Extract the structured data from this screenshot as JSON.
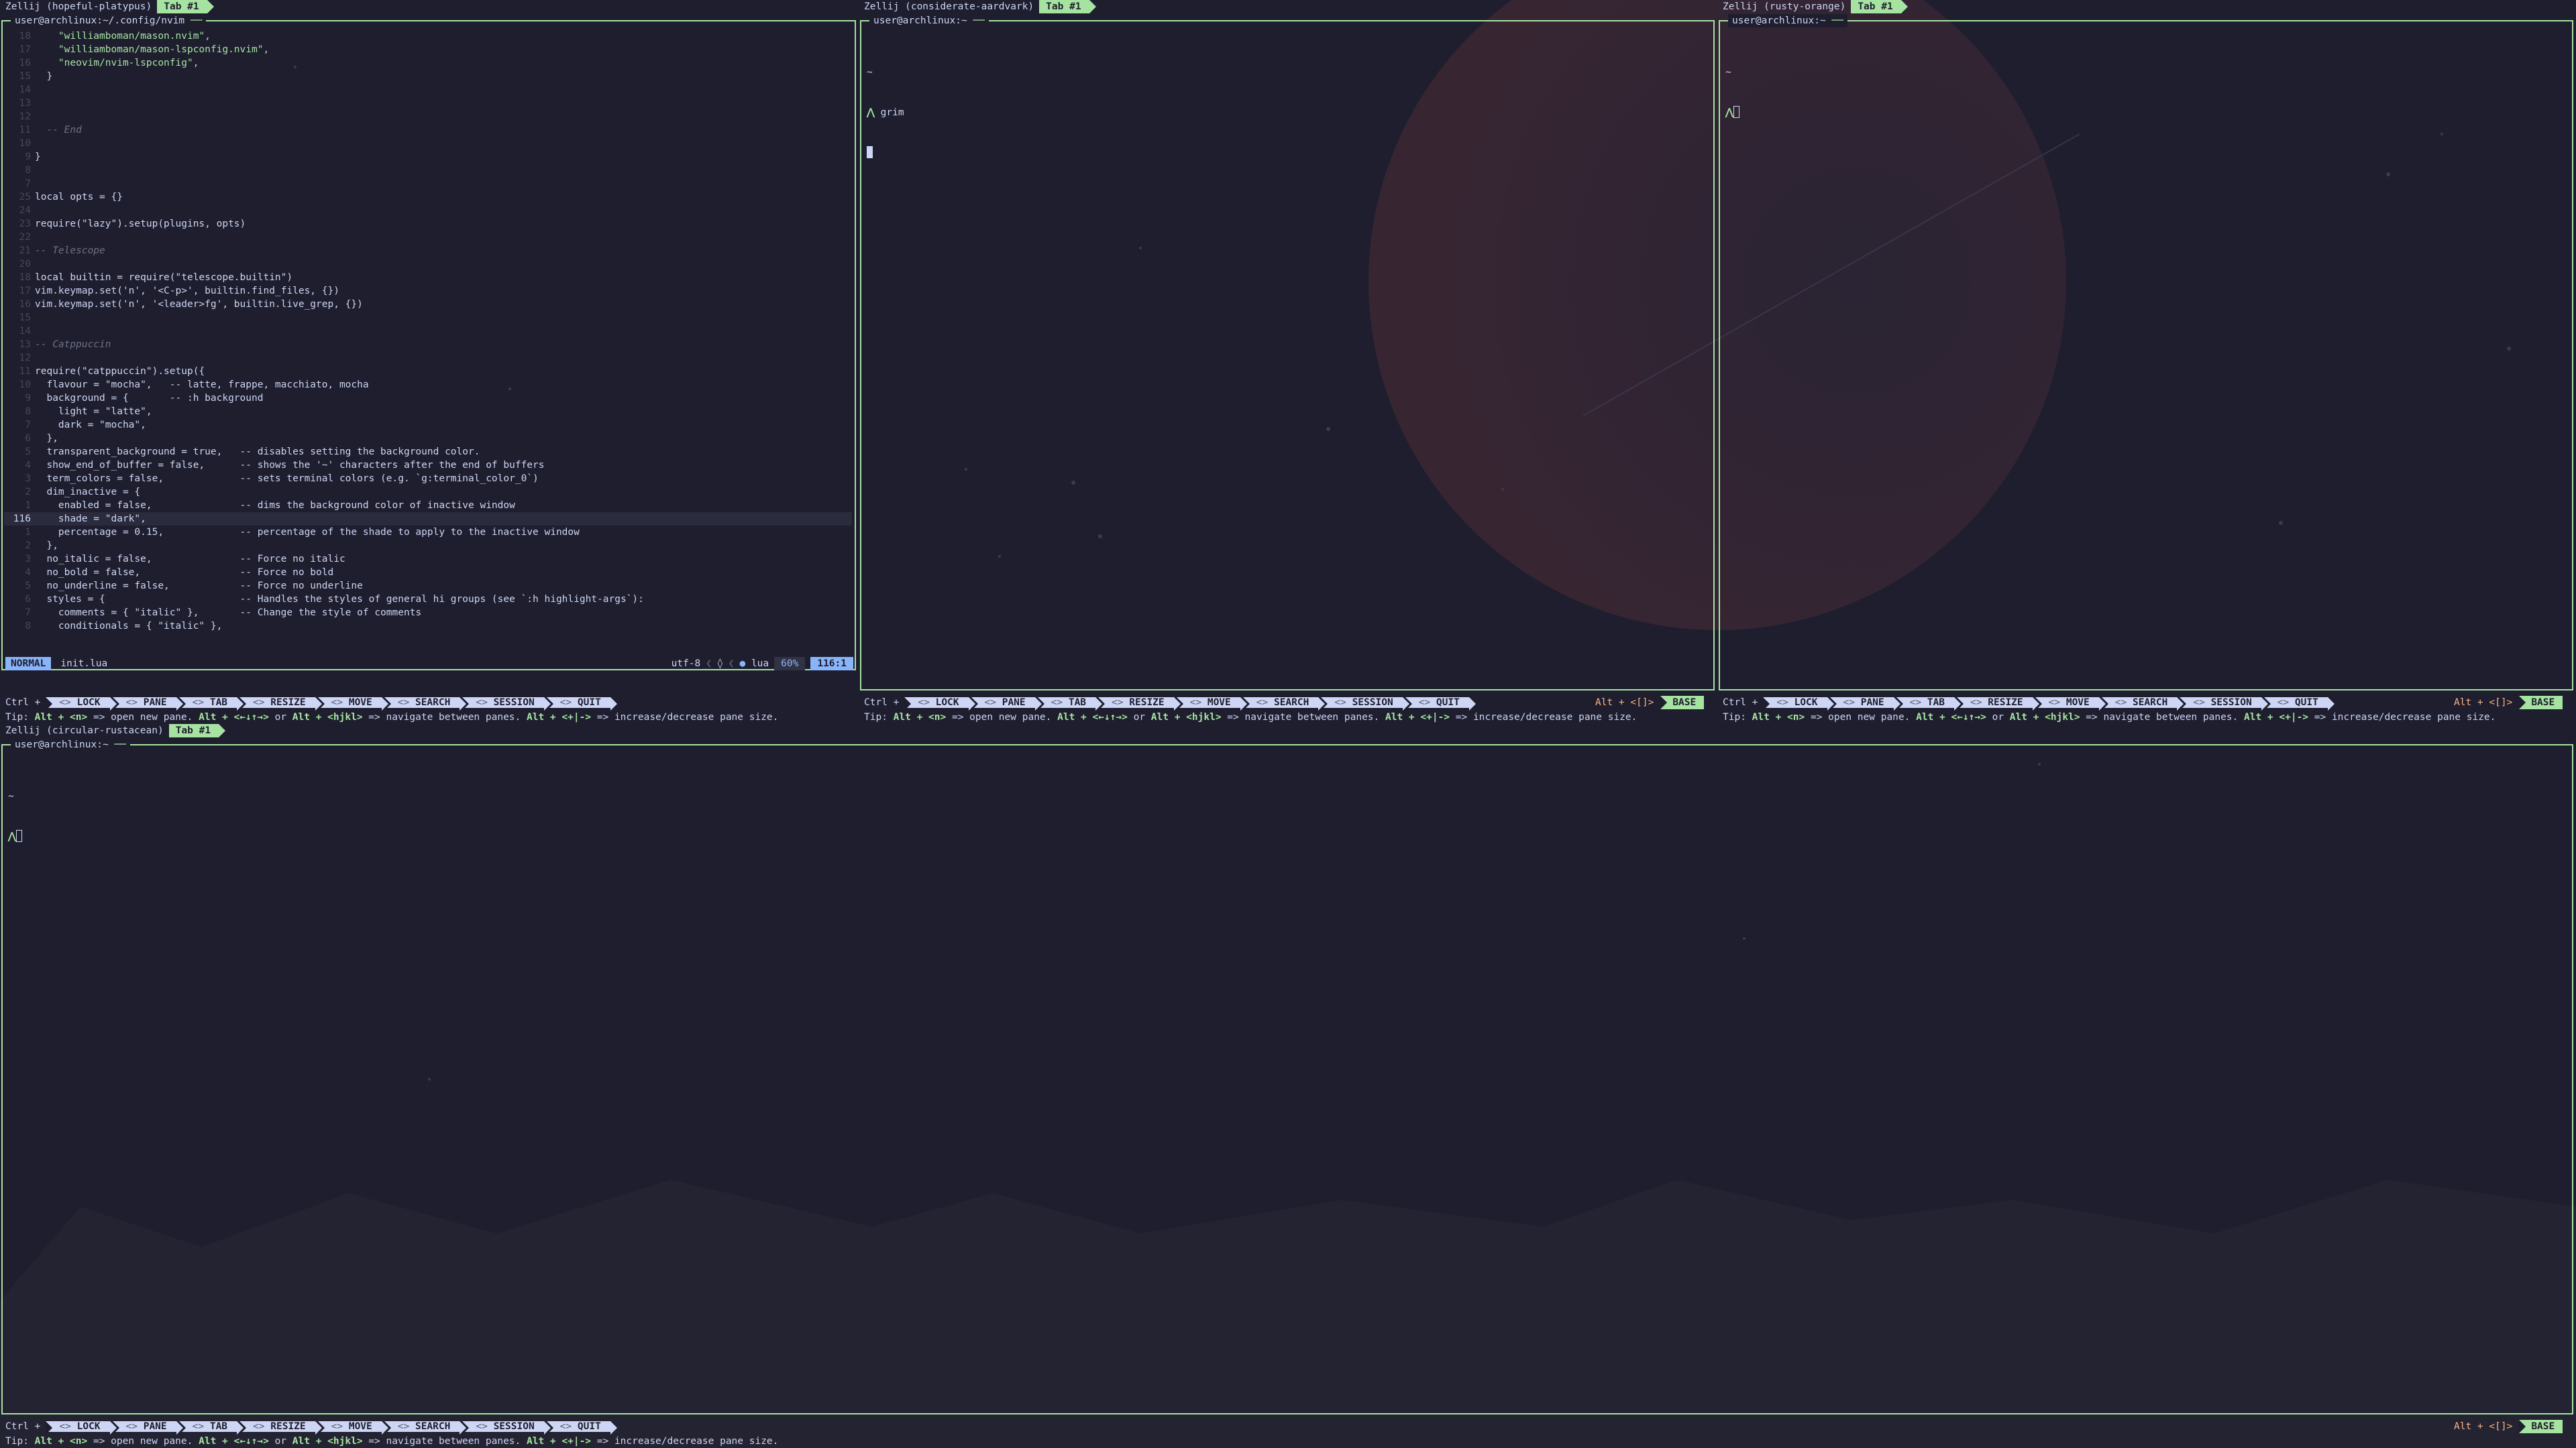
{
  "colors": {
    "bg": "#1e1e2e",
    "accent": "#a6e3a1",
    "blue": "#89b4fa",
    "peach": "#fab387",
    "text": "#cdd6f4",
    "comment": "#6c7086"
  },
  "sessions": {
    "top_left": {
      "name": "Zellij (hopeful-platypus)",
      "tab": "Tab #1"
    },
    "top_middle": {
      "name": "Zellij (considerate-aardvark)",
      "tab": "Tab #1"
    },
    "top_right": {
      "name": "Zellij (rusty-orange)",
      "tab": "Tab #1"
    },
    "bottom": {
      "name": "Zellij (circular-rustacean)",
      "tab": "Tab #1"
    }
  },
  "panes": {
    "nvim_title": "user@archlinux:~/.config/nvim",
    "middle_title": "user@archlinux:~",
    "right_title": "user@archlinux:~",
    "bottom_title": "user@archlinux:~",
    "middle_cwd": "~",
    "middle_cmd": "grim",
    "right_cwd": "~",
    "bottom_cwd": "~"
  },
  "nvim": {
    "lines": [
      {
        "n": "18",
        "t": "    \"williamboman/mason.nvim\",",
        "k": "st"
      },
      {
        "n": "17",
        "t": "    \"williamboman/mason-lspconfig.nvim\",",
        "k": "st"
      },
      {
        "n": "16",
        "t": "    \"neovim/nvim-lspconfig\",",
        "k": "st"
      },
      {
        "n": "15",
        "t": "  }",
        "k": "va"
      },
      {
        "n": "14",
        "t": "",
        "k": "va"
      },
      {
        "n": "13",
        "t": "",
        "k": "va"
      },
      {
        "n": "12",
        "t": "",
        "k": "va"
      },
      {
        "n": "11",
        "t": "  -- End",
        "k": "cm"
      },
      {
        "n": "10",
        "t": "",
        "k": "va"
      },
      {
        "n": "9",
        "t": "}",
        "k": "va"
      },
      {
        "n": "8",
        "t": "",
        "k": "va"
      },
      {
        "n": "7",
        "t": "",
        "k": "va"
      },
      {
        "n": "25",
        "t": "local opts = {}",
        "k": "va"
      },
      {
        "n": "24",
        "t": "",
        "k": "va"
      },
      {
        "n": "23",
        "t": "require(\"lazy\").setup(plugins, opts)",
        "k": "va"
      },
      {
        "n": "22",
        "t": "",
        "k": "va"
      },
      {
        "n": "21",
        "t": "-- Telescope",
        "k": "cm"
      },
      {
        "n": "20",
        "t": "",
        "k": "va"
      },
      {
        "n": "18",
        "t": "local builtin = require(\"telescope.builtin\")",
        "k": "va"
      },
      {
        "n": "17",
        "t": "vim.keymap.set('n', '<C-p>', builtin.find_files, {})",
        "k": "va"
      },
      {
        "n": "16",
        "t": "vim.keymap.set('n', '<leader>fg', builtin.live_grep, {})",
        "k": "va"
      },
      {
        "n": "15",
        "t": "",
        "k": "va"
      },
      {
        "n": "14",
        "t": "",
        "k": "va"
      },
      {
        "n": "13",
        "t": "-- Catppuccin",
        "k": "cm"
      },
      {
        "n": "12",
        "t": "",
        "k": "va"
      },
      {
        "n": "11",
        "t": "require(\"catppuccin\").setup({",
        "k": "va"
      },
      {
        "n": "10",
        "t": "  flavour = \"mocha\",   -- latte, frappe, macchiato, mocha",
        "k": "va"
      },
      {
        "n": "9",
        "t": "  background = {       -- :h background",
        "k": "va"
      },
      {
        "n": "8",
        "t": "    light = \"latte\",",
        "k": "va"
      },
      {
        "n": "7",
        "t": "    dark = \"mocha\",",
        "k": "va"
      },
      {
        "n": "6",
        "t": "  },",
        "k": "va"
      },
      {
        "n": "5",
        "t": "  transparent_background = true,   -- disables setting the background color.",
        "k": "va"
      },
      {
        "n": "4",
        "t": "  show_end_of_buffer = false,      -- shows the '~' characters after the end of buffers",
        "k": "va"
      },
      {
        "n": "3",
        "t": "  term_colors = false,             -- sets terminal colors (e.g. `g:terminal_color_0`)",
        "k": "va"
      },
      {
        "n": "2",
        "t": "  dim_inactive = {",
        "k": "va"
      },
      {
        "n": "1",
        "t": "    enabled = false,               -- dims the background color of inactive window",
        "k": "va"
      },
      {
        "n": "116",
        "t": "    shade = \"dark\",",
        "k": "va",
        "cur": true
      },
      {
        "n": "1",
        "t": "    percentage = 0.15,             -- percentage of the shade to apply to the inactive window",
        "k": "va"
      },
      {
        "n": "2",
        "t": "  },",
        "k": "va"
      },
      {
        "n": "3",
        "t": "  no_italic = false,               -- Force no italic",
        "k": "va"
      },
      {
        "n": "4",
        "t": "  no_bold = false,                 -- Force no bold",
        "k": "va"
      },
      {
        "n": "5",
        "t": "  no_underline = false,            -- Force no underline",
        "k": "va"
      },
      {
        "n": "6",
        "t": "  styles = {                       -- Handles the styles of general hi groups (see `:h highlight-args`):",
        "k": "va"
      },
      {
        "n": "7",
        "t": "    comments = { \"italic\" },       -- Change the style of comments",
        "k": "va"
      },
      {
        "n": "8",
        "t": "    conditionals = { \"italic\" },",
        "k": "va"
      }
    ],
    "mode": "NORMAL",
    "filename": "init.lua",
    "encoding": "utf-8",
    "filetype": "lua",
    "percent": "60%",
    "position": "116:1"
  },
  "statusbar": {
    "ctrl": "Ctrl +",
    "keys": [
      {
        "label": "LOCK"
      },
      {
        "label": "PANE"
      },
      {
        "label": "TAB"
      },
      {
        "label": "RESIZE"
      },
      {
        "label": "MOVE"
      },
      {
        "label": "SEARCH"
      },
      {
        "label": "SESSION"
      },
      {
        "label": "QUIT"
      }
    ],
    "key_hint": "<>",
    "alt": "Alt + <[]>",
    "base": "BASE"
  },
  "tip": {
    "prefix": "Tip: ",
    "p1": "Alt + <n>",
    "t1": " => open new pane. ",
    "p2": "Alt + <←↓↑→>",
    "t2": " or ",
    "p3": "Alt + <hjkl>",
    "t3": " => navigate between panes. ",
    "p4": "Alt + <+|->",
    "t4": " => increase/decrease pane size."
  }
}
